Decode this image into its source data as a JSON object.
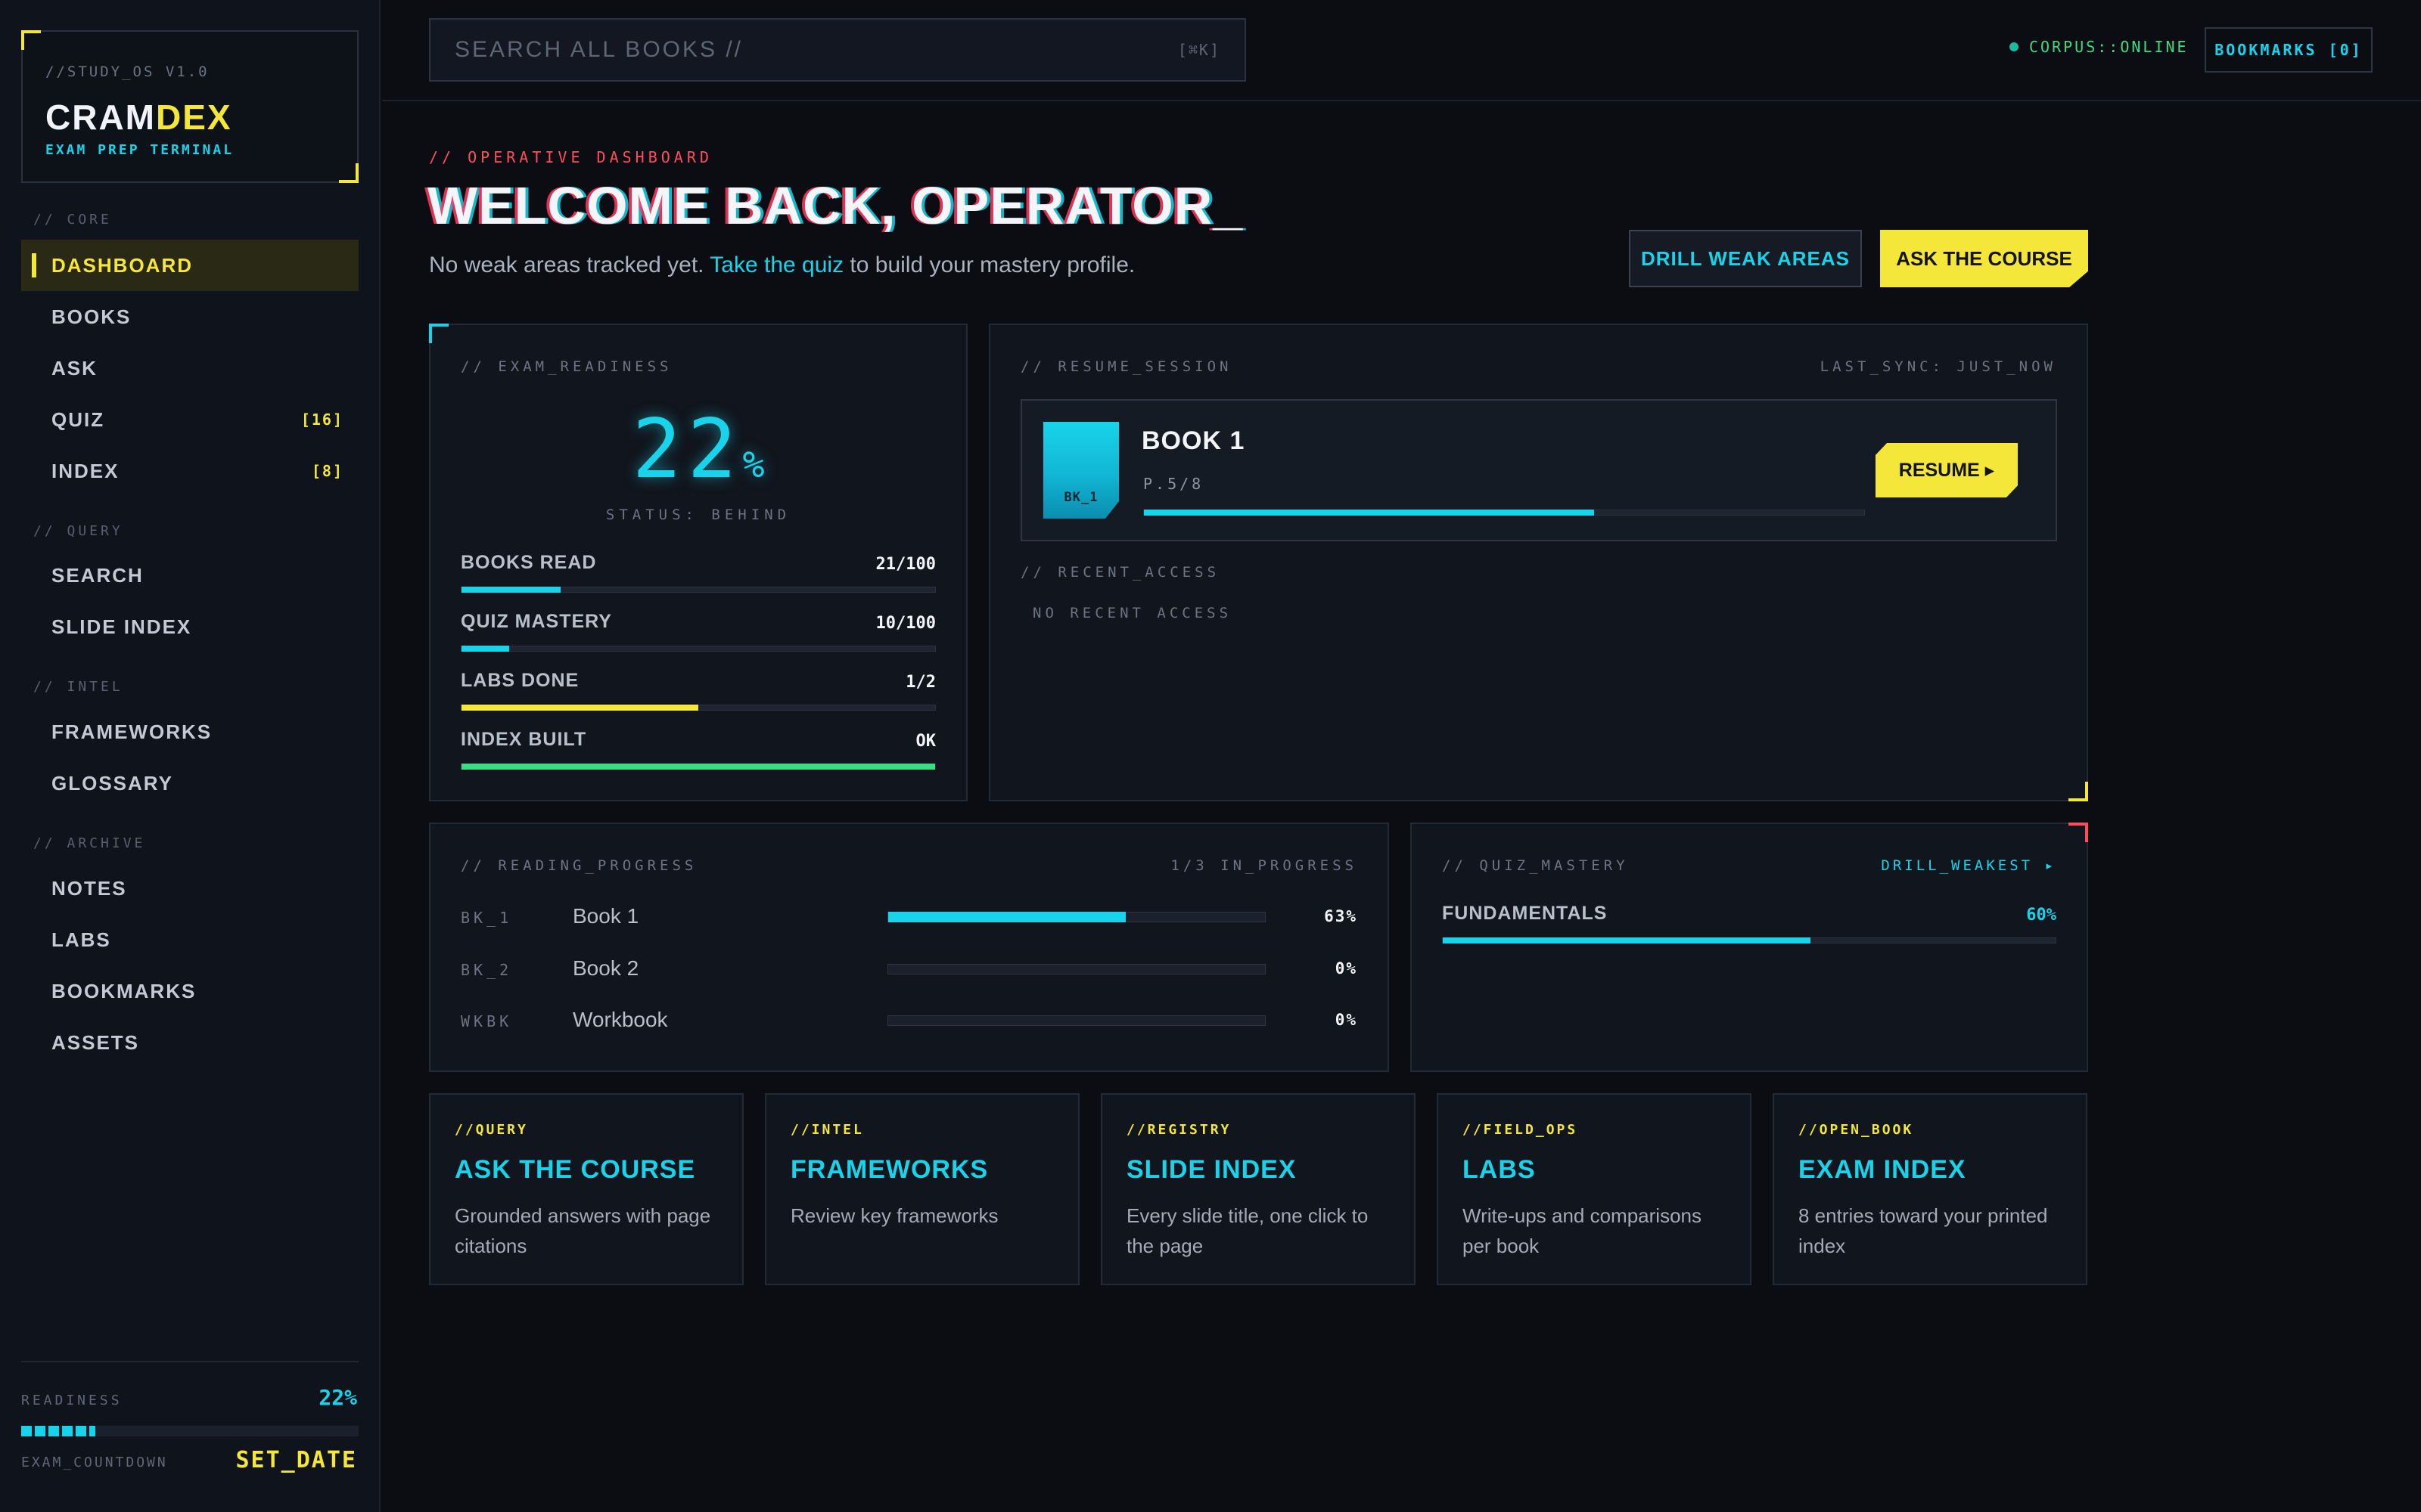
{
  "sidebar": {
    "version": "//STUDY_OS V1.0",
    "brand_a": "CRAM",
    "brand_b": "DEX",
    "tagline": "EXAM PREP TERMINAL",
    "sections": {
      "core": "// CORE",
      "query": "// QUERY",
      "intel": "// INTEL",
      "archive": "// ARCHIVE"
    },
    "items": {
      "dashboard": "DASHBOARD",
      "books": "BOOKS",
      "ask": "ASK",
      "quiz": "QUIZ",
      "quiz_badge": "[16]",
      "index": "INDEX",
      "index_badge": "[8]",
      "search": "SEARCH",
      "slide_index": "SLIDE INDEX",
      "frameworks": "FRAMEWORKS",
      "glossary": "GLOSSARY",
      "notes": "NOTES",
      "labs": "LABS",
      "bookmarks": "BOOKMARKS",
      "assets": "ASSETS"
    },
    "footer": {
      "readiness_label": "READINESS",
      "readiness_value": "22%",
      "readiness_fraction": 0.22,
      "countdown_label": "EXAM_COUNTDOWN",
      "countdown_value": "SET_DATE"
    }
  },
  "topbar": {
    "search_placeholder": "SEARCH ALL BOOKS //",
    "search_shortcut": "[⌘K]",
    "corpus_status": "CORPUS::ONLINE",
    "bookmarks_label": "BOOKMARKS [0]"
  },
  "hero": {
    "kicker": "// OPERATIVE DASHBOARD",
    "title": "WELCOME BACK, OPERATOR_",
    "sub_before": "No weak areas tracked yet. ",
    "sub_link": "Take the quiz",
    "sub_after": " to build your mastery profile.",
    "btn_drill": "DRILL WEAK AREAS",
    "btn_ask": "ASK THE COURSE"
  },
  "readiness": {
    "label": "// EXAM_READINESS",
    "value": "22",
    "unit": "%",
    "status": "STATUS: BEHIND",
    "metrics": [
      {
        "label": "BOOKS READ",
        "value": "21/100",
        "fraction": 0.21,
        "color": "#19d3ea"
      },
      {
        "label": "QUIZ MASTERY",
        "value": "10/100",
        "fraction": 0.1,
        "color": "#19d3ea"
      },
      {
        "label": "LABS DONE",
        "value": "1/2",
        "fraction": 0.5,
        "color": "#f5e63a"
      },
      {
        "label": "INDEX BUILT",
        "value": "OK",
        "fraction": 1.0,
        "color": "#3ddc84"
      }
    ]
  },
  "resume": {
    "label": "// RESUME_SESSION",
    "last_sync": "LAST_SYNC: JUST_NOW",
    "book_code": "BK_1",
    "book_title": "BOOK 1",
    "page": "P.5/8",
    "fraction": 0.625,
    "resume_label": "RESUME ▸",
    "recent_label": "// RECENT_ACCESS",
    "recent_empty": "NO RECENT ACCESS"
  },
  "reading": {
    "label": "// READING_PROGRESS",
    "summary": "1/3 IN_PROGRESS",
    "rows": [
      {
        "code": "BK_1",
        "name": "Book 1",
        "pct": "63%",
        "fraction": 0.63
      },
      {
        "code": "BK_2",
        "name": "Book 2",
        "pct": "0%",
        "fraction": 0
      },
      {
        "code": "WKBK",
        "name": "Workbook",
        "pct": "0%",
        "fraction": 0
      }
    ]
  },
  "quiz_mastery": {
    "label": "// QUIZ_MASTERY",
    "drill": "DRILL_WEAKEST ▸",
    "topic": "FUNDAMENTALS",
    "value": "60%",
    "fraction": 0.6
  },
  "cards": [
    {
      "tag": "//QUERY",
      "title": "ASK THE COURSE",
      "desc": "Grounded answers with page citations"
    },
    {
      "tag": "//INTEL",
      "title": "FRAMEWORKS",
      "desc": "Review key frameworks"
    },
    {
      "tag": "//REGISTRY",
      "title": "SLIDE INDEX",
      "desc": "Every slide title, one click to the page"
    },
    {
      "tag": "//FIELD_OPS",
      "title": "LABS",
      "desc": "Write-ups and comparisons per book"
    },
    {
      "tag": "//OPEN_BOOK",
      "title": "EXAM INDEX",
      "desc": "8 entries toward your printed index"
    }
  ],
  "colors": {
    "accent_cyan": "#19d3ea",
    "accent_yellow": "#f5e63a",
    "accent_red": "#ff4d5e",
    "accent_green": "#3ddc84",
    "background": "#0b0d12"
  }
}
